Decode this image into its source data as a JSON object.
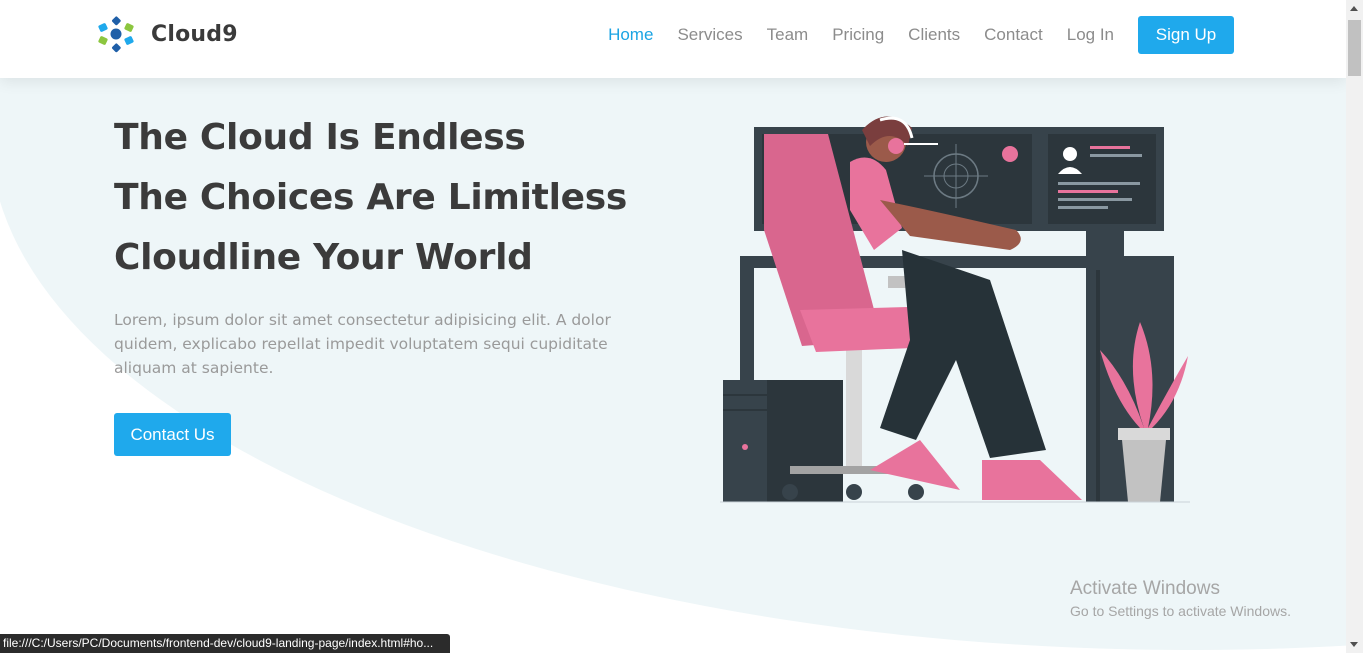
{
  "brand": {
    "name": "Cloud9",
    "logo_icon": "cloud9-logo-icon"
  },
  "nav": {
    "links": [
      {
        "label": "Home",
        "active": true
      },
      {
        "label": "Services",
        "active": false
      },
      {
        "label": "Team",
        "active": false
      },
      {
        "label": "Pricing",
        "active": false
      },
      {
        "label": "Clients",
        "active": false
      },
      {
        "label": "Contact",
        "active": false
      },
      {
        "label": "Log In",
        "active": false
      }
    ],
    "signup_label": "Sign Up"
  },
  "hero": {
    "headline_lines": [
      "The Cloud Is Endless",
      "The Choices Are Limitless",
      "Cloudline Your World"
    ],
    "paragraph": "Lorem, ipsum dolor sit amet consectetur adipisicing elit. A dolor quidem, explicabo repellat impedit voluptatem sequi cupiditate aliquam at sapiente.",
    "cta_label": "Contact Us"
  },
  "watermark": {
    "title": "Activate Windows",
    "subtitle": "Go to Settings to activate Windows."
  },
  "status_bar": {
    "url": "file:///C:/Users/PC/Documents/frontend-dev/cloud9-landing-page/index.html#ho..."
  },
  "colors": {
    "accent": "#1fa9ec",
    "active_link": "#1ba4e3",
    "hero_bg": "#eef6f8",
    "heading": "#3b3b3b",
    "pink": "#e8739c"
  }
}
